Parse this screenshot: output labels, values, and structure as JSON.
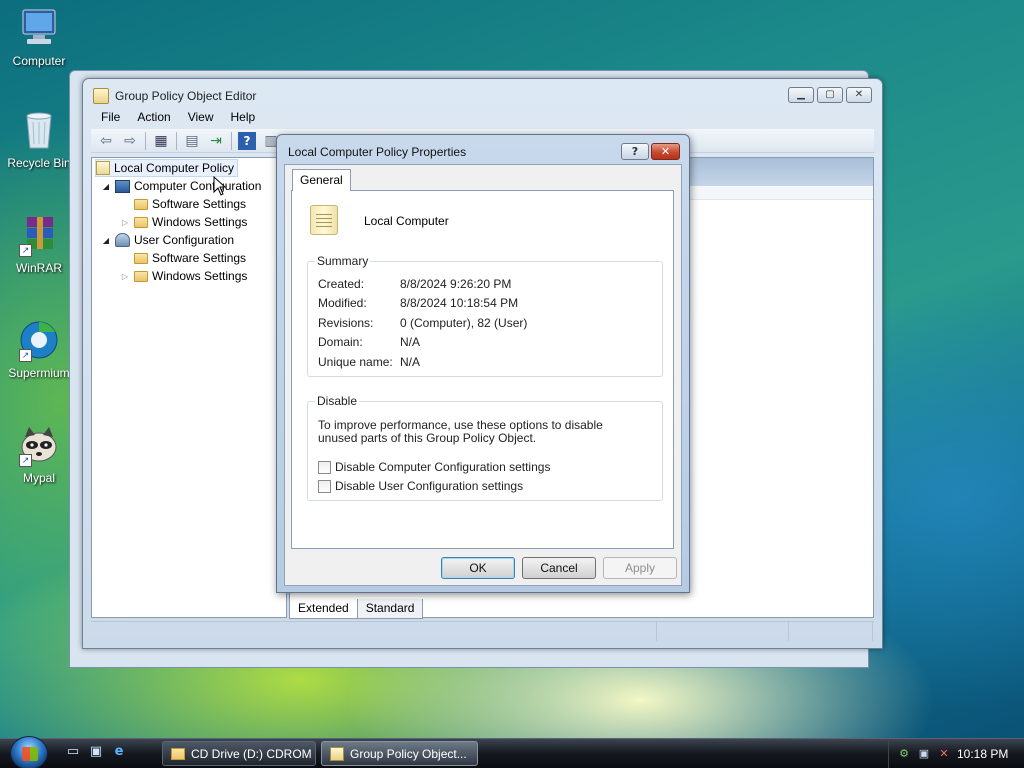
{
  "desktop": {
    "icons": [
      {
        "label": "Computer"
      },
      {
        "label": "Recycle Bin"
      },
      {
        "label": "WinRAR"
      },
      {
        "label": "Supermium"
      },
      {
        "label": "Mypal"
      }
    ]
  },
  "gpo_window": {
    "title": "Group Policy Object Editor",
    "menu": [
      "File",
      "Action",
      "View",
      "Help"
    ],
    "tree": {
      "root": "Local Computer Policy",
      "computer_config": "Computer Configuration",
      "cc_software": "Software Settings",
      "cc_windows": "Windows Settings",
      "user_config": "User Configuration",
      "uc_software": "Software Settings",
      "uc_windows": "Windows Settings"
    },
    "bottom_tabs": [
      "Extended",
      "Standard"
    ]
  },
  "dialog": {
    "title": "Local Computer Policy Properties",
    "tab": "General",
    "object_name": "Local Computer",
    "summary": {
      "label": "Summary",
      "created_label": "Created:",
      "created_value": "8/8/2024 9:26:20 PM",
      "modified_label": "Modified:",
      "modified_value": "8/8/2024 10:18:54 PM",
      "revisions_label": "Revisions:",
      "revisions_value": "0 (Computer), 82 (User)",
      "domain_label": "Domain:",
      "domain_value": "N/A",
      "unique_label": "Unique name:",
      "unique_value": "N/A"
    },
    "disable": {
      "label": "Disable",
      "description": "To improve performance, use these options to disable unused parts of this Group Policy Object.",
      "opt_computer": "Disable Computer Configuration settings",
      "opt_user": "Disable User Configuration settings"
    },
    "buttons": {
      "ok": "OK",
      "cancel": "Cancel",
      "apply": "Apply"
    }
  },
  "taskbar": {
    "tasks": [
      {
        "label": "CD Drive (D:) CDROM"
      },
      {
        "label": "Group Policy Object..."
      }
    ],
    "clock": "10:18 PM"
  }
}
